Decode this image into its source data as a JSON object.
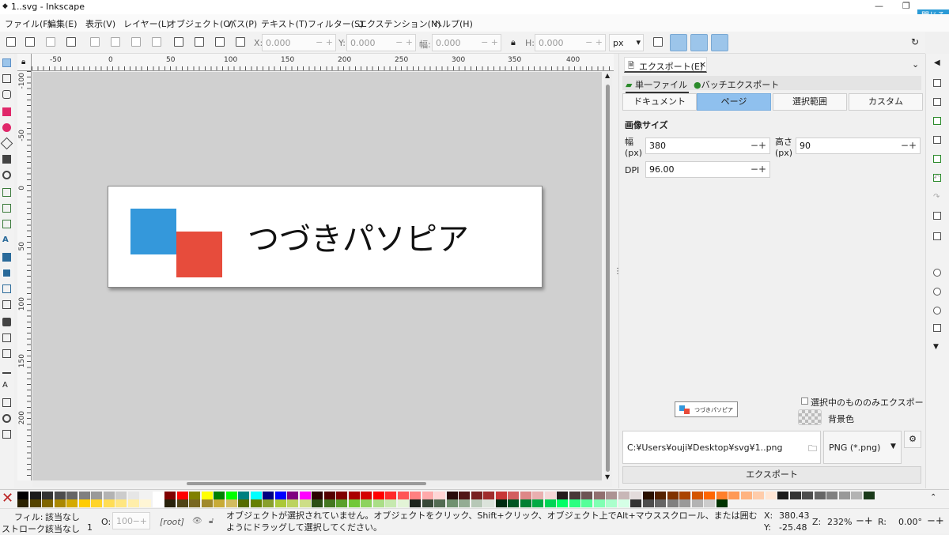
{
  "window": {
    "title": "1..svg - Inkscape",
    "close_label": "閉じる"
  },
  "menu": [
    "ファイル(F)",
    "編集(E)",
    "表示(V)",
    "レイヤー(L)",
    "オブジェクト(O)",
    "パス(P)",
    "テキスト(T)",
    "フィルター(S)",
    "エクステンション(N)",
    "ヘルプ(H)"
  ],
  "toolbar": {
    "x_label": "X:",
    "x_value": "0.000",
    "y_label": "Y:",
    "y_value": "0.000",
    "w_label": "幅:",
    "w_value": "0.000",
    "h_label": "H:",
    "h_value": "0.000",
    "unit": "px"
  },
  "ruler": {
    "h_ticks": [
      "-50",
      "0",
      "50",
      "100",
      "150",
      "200",
      "250",
      "300",
      "350",
      "400"
    ],
    "v_ticks": [
      "-100",
      "-50",
      "0",
      "50",
      "100",
      "150",
      "200"
    ]
  },
  "canvas": {
    "page_text": "つづきパソピア",
    "blue": "#3498db",
    "red": "#e74c3c"
  },
  "export_panel": {
    "tab_title": "エクスポート(E)",
    "subtabs": [
      "単一ファイル",
      "バッチエクスポート"
    ],
    "area_buttons": [
      "ドキュメント",
      "ページ",
      "選択範囲",
      "カスタム"
    ],
    "active_area": "ページ",
    "image_size_heading": "画像サイズ",
    "width_label": "幅",
    "width_unit": "(px)",
    "width_value": "380",
    "height_label": "高さ",
    "height_unit": "(px)",
    "height_value": "90",
    "dpi_label": "DPI",
    "dpi_value": "96.00",
    "preview_text": "つづきパソピア",
    "only_selected_label": "選択中のもののみエクスポート",
    "background_label": "背景色",
    "filepath": "C:¥Users¥ouji¥Desktop¥svg¥1..png",
    "format": "PNG (*.png)",
    "export_button": "エクスポート"
  },
  "status": {
    "fill_label": "フィル:",
    "fill_value": "該当なし",
    "stroke_label": "ストローク:",
    "stroke_value": "該当なし",
    "stroke_width": "1",
    "opacity_label": "O:",
    "opacity_value": "100",
    "layer": "[root]",
    "message": "オブジェクトが選択されていません。オブジェクトをクリック、Shift+クリック、オブジェクト上でAlt+マウススクロール、または囲むようにドラッグして選択してください。",
    "x_label": "X:",
    "x_value": "380.43",
    "y_label": "Y:",
    "y_value": "-25.48",
    "zoom_label": "Z:",
    "zoom_value": "232%",
    "rot_label": "R:",
    "rot_value": "0.00°"
  },
  "palette_colors": {
    "row1": [
      "#000000",
      "#1a1a1a",
      "#333333",
      "#4d4d4d",
      "#666666",
      "#808080",
      "#999999",
      "#b3b3b3",
      "#cccccc",
      "#e6e6e6",
      "#f2f2f2",
      "#ffffff",
      "#800000",
      "#ff0000",
      "#808000",
      "#ffff00",
      "#008000",
      "#00ff00",
      "#008080",
      "#00ffff",
      "#000080",
      "#0000ff",
      "#800080",
      "#ff00ff",
      "#2b0000",
      "#550000",
      "#800000",
      "#aa0000",
      "#d40000",
      "#ff0000",
      "#ff2a2a",
      "#ff5555",
      "#ff8080",
      "#ffaaaa",
      "#ffd5d5",
      "#280b0b",
      "#501616",
      "#782121",
      "#a02c2c",
      "#c83737",
      "#d35f5f",
      "#de8787",
      "#e9afaf",
      "#f4d7d7",
      "#241c1c",
      "#483737",
      "#6c5353",
      "#916f6f",
      "#ac9393",
      "#c8b7b7",
      "#e3dbdb",
      "#2b1100",
      "#552200",
      "#803300",
      "#aa4400",
      "#d45500",
      "#ff6600",
      "#ff7f2a",
      "#ff9955",
      "#ffb380",
      "#ffccaa",
      "#ffe6d5",
      "#1a1a1a",
      "#333333",
      "#4d4d4d",
      "#666666",
      "#808080",
      "#999999",
      "#b3b3b3",
      "#1a3a1a"
    ],
    "row2": [
      "#2b2200",
      "#554400",
      "#806600",
      "#aa8800",
      "#d4aa00",
      "#ffcc00",
      "#ffd42a",
      "#ffdd55",
      "#ffe680",
      "#ffeeaa",
      "#fff6d5",
      "#ffffff",
      "#28220b",
      "#504416",
      "#786721",
      "#a0892c",
      "#c8ab37",
      "#d3bc5f",
      "#556b00",
      "#668000",
      "#89a02c",
      "#abc837",
      "#bcd35f",
      "#cdde87",
      "#2d5016",
      "#447821",
      "#5aa02c",
      "#71c837",
      "#8dd35f",
      "#aade87",
      "#c6e9af",
      "#e3f4d7",
      "#1c241c",
      "#374837",
      "#536c53",
      "#6f916f",
      "#93ac93",
      "#b7c8b7",
      "#dbe3db",
      "#002b11",
      "#005522",
      "#008033",
      "#00aa44",
      "#00d455",
      "#00ff66",
      "#2aff80",
      "#55ff99",
      "#80ffb3",
      "#aaffcc",
      "#d5ffe6",
      "#333333",
      "#4d4d4d",
      "#666666",
      "#808080",
      "#999999",
      "#b3b3b3",
      "#cccccc",
      "#003300"
    ]
  }
}
